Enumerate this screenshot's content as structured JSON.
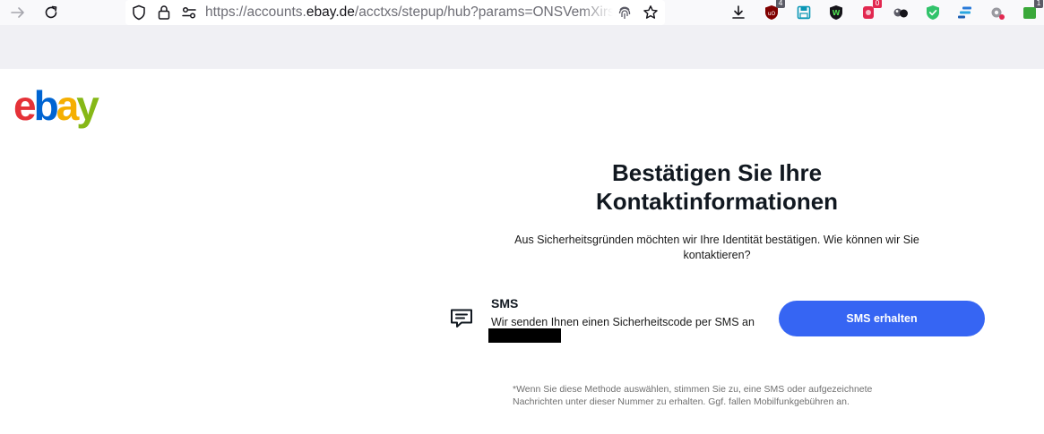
{
  "browser": {
    "url_prefix": "https://accounts.",
    "url_domain": "ebay.de",
    "url_path": "/acctxs/stepup/hub?params=ONSVemXirsu",
    "extensions": [
      {
        "name": "ublock",
        "badge": "4",
        "color": "#800000"
      },
      {
        "name": "save",
        "badge": "",
        "color": "#0996b5"
      },
      {
        "name": "shield-w",
        "badge": "",
        "color": "#15141a"
      },
      {
        "name": "red-ext",
        "badge": "0",
        "color": "#e22850"
      },
      {
        "name": "gray-ext",
        "badge": "",
        "color": "#5b5b66"
      },
      {
        "name": "green-shield",
        "badge": "",
        "color": "#32c36b"
      },
      {
        "name": "blue-ext",
        "badge": "",
        "color": "#2a7ad8"
      },
      {
        "name": "gear-ext",
        "badge": "",
        "color": "#7a7a80"
      },
      {
        "name": "green-ext",
        "badge": "1",
        "color": "#3aa83a"
      }
    ]
  },
  "logo": {
    "text": "ebay",
    "colors": {
      "e": "#e53238",
      "b": "#0064d2",
      "a": "#f5af02",
      "y": "#86b817"
    }
  },
  "main": {
    "title_line1": "Bestätigen Sie Ihre",
    "title_line2": "Kontaktinformationen",
    "subtitle_line1": "Aus Sicherheitsgründen möchten wir Ihre Identität bestätigen. Wie können wir Sie",
    "subtitle_line2": "kontaktieren?",
    "sms": {
      "title": "SMS",
      "description": "Wir senden Ihnen einen Sicherheitscode per SMS an",
      "button_label": "SMS erhalten"
    },
    "disclaimer_line1": "*Wenn Sie diese Methode auswählen, stimmen Sie zu, eine SMS oder aufgezeichnete",
    "disclaimer_line2": "Nachrichten unter dieser Nummer zu erhalten. Ggf. fallen Mobilfunkgebühren an."
  },
  "colors": {
    "accent": "#3665f3",
    "text": "#111820"
  }
}
